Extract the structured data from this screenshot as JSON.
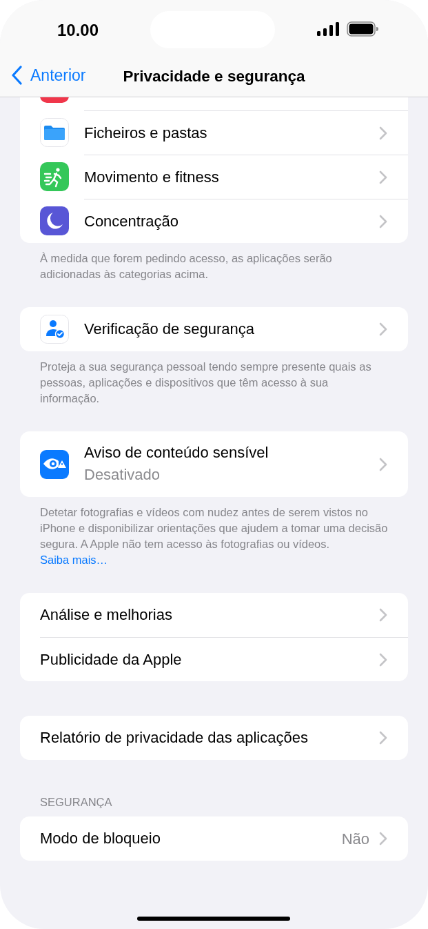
{
  "status_bar": {
    "time": "10.00"
  },
  "nav": {
    "back": "Anterior",
    "title": "Privacidade e segurança"
  },
  "sections": [
    {
      "rows": [
        {
          "kind": "clipped"
        },
        {
          "kind": "row",
          "label": "Ficheiros e pastas"
        },
        {
          "kind": "row",
          "label": "Movimento e fitness"
        },
        {
          "kind": "row",
          "label": "Concentração"
        }
      ],
      "footer": "À medida que forem pedindo acesso, as aplicações serão adicionadas às categorias acima."
    },
    {
      "rows": [
        {
          "kind": "row",
          "label": "Verificação de segurança"
        }
      ],
      "footer": "Proteja a sua segurança pessoal tendo sempre presente quais as pessoas, aplicações e dispositivos que têm acesso à sua informação."
    },
    {
      "rows": [
        {
          "kind": "row",
          "label": "Aviso de conteúdo sensível",
          "subtitle": "Desativado"
        }
      ],
      "footer": "Detetar fotografias e vídeos com nudez antes de serem vistos no iPhone e disponibilizar orientações que ajudem a tomar uma decisão segura. A Apple não tem acesso às fotografias ou vídeos.",
      "footer_link": "Saiba mais…"
    },
    {
      "rows": [
        {
          "kind": "row",
          "label": "Análise e melhorias"
        },
        {
          "kind": "row",
          "label": "Publicidade da Apple"
        }
      ]
    },
    {
      "rows": [
        {
          "kind": "row",
          "label": "Relatório de privacidade das aplicações"
        }
      ]
    },
    {
      "header": "SEGURANÇA",
      "rows": [
        {
          "kind": "row",
          "label": "Modo de bloqueio",
          "value": "Não"
        }
      ]
    }
  ]
}
